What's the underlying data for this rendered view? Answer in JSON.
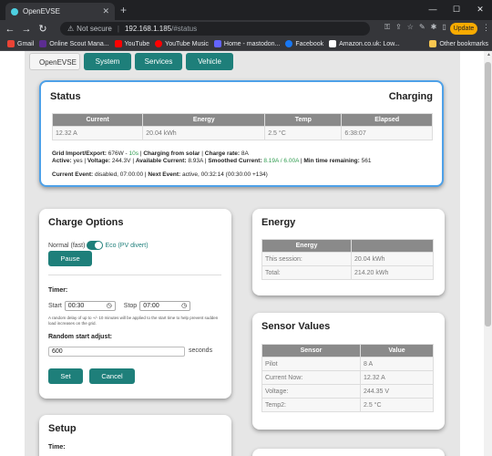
{
  "browser": {
    "tab_title": "OpenEVSE",
    "tab_close": "✕",
    "new_tab": "+",
    "window_controls": [
      "—",
      "☐",
      "✕"
    ],
    "nav": [
      "←",
      "→",
      "↻"
    ],
    "security_label": "Not secure",
    "url_host": "192.168.1.185",
    "url_path": "/#status",
    "update_label": "Update",
    "bookmarks": [
      {
        "label": "Gmail",
        "color": "#ea4335"
      },
      {
        "label": "Online Scout Mana...",
        "color": "#5c2d91"
      },
      {
        "label": "YouTube",
        "color": "#ff0000"
      },
      {
        "label": "YouTube Music",
        "color": "#ff0000"
      },
      {
        "label": "Home - mastodon...",
        "color": "#6364ff"
      },
      {
        "label": "Facebook",
        "color": "#1877f2"
      },
      {
        "label": "Amazon.co.uk: Low...",
        "color": "#ffffff"
      }
    ],
    "other_bookmarks": "Other bookmarks"
  },
  "nav_tabs": [
    "OpenEVSE",
    "System",
    "Services",
    "Vehicle"
  ],
  "status": {
    "title": "Status",
    "state": "Charging",
    "headers": [
      "Current",
      "Energy",
      "Temp",
      "Elapsed"
    ],
    "values": [
      "12.32 A",
      "20.04 kWh",
      "2.5 °C",
      "6:38:07"
    ],
    "line1_a": "Grid Import/Export:",
    "line1_b": "676W -",
    "line1_c": "10s",
    "line1_d": "|",
    "line1_e": "Charging from solar",
    "line1_f": "|",
    "line1_g": "Charge rate:",
    "line1_h": "8A",
    "line2_a": "Active:",
    "line2_b": "yes |",
    "line2_c": "Voltage:",
    "line2_d": "244.3V |",
    "line2_e": "Available Current:",
    "line2_f": "8.93A |",
    "line2_g": "Smoothed Current:",
    "line2_h": "8.19A / 6.00A",
    "line2_i": "|",
    "line2_j": "Min time remaining:",
    "line2_k": "561",
    "line3_a": "Current Event:",
    "line3_b": "disabled, 07:00:00 |",
    "line3_c": "Next Event:",
    "line3_d": "active, 00:32:14 (00:30:00 +134)"
  },
  "charge": {
    "title": "Charge Options",
    "mode_normal": "Normal (fast)",
    "mode_eco": "Eco (PV divert)",
    "pause": "Pause",
    "timer_label": "Timer:",
    "start_label": "Start",
    "start_value": "00:30",
    "stop_label": "Stop",
    "stop_value": "07:00",
    "note": "A random delay of up to +/- 10 minutes will be applied to the start time to help prevent sudden load increases on the grid.",
    "random_label": "Random start adjust:",
    "random_value": "600",
    "seconds": "seconds",
    "set": "Set",
    "cancel": "Cancel"
  },
  "energy": {
    "title": "Energy",
    "header": "Energy",
    "rows": [
      [
        "This session:",
        "20.04 kWh"
      ],
      [
        "Total:",
        "214.20 kWh"
      ]
    ]
  },
  "sensor": {
    "title": "Sensor Values",
    "headers": [
      "Sensor",
      "Value"
    ],
    "rows": [
      [
        "Pilot",
        "8 A"
      ],
      [
        "Current Now:",
        "12.32 A"
      ],
      [
        "Voltage:",
        "244.35 V"
      ],
      [
        "Temp2:",
        "2.5 °C"
      ]
    ]
  },
  "setup": {
    "title": "Setup",
    "timer_label": "Time:"
  },
  "colors": {
    "teal": "#1e7f7a",
    "accent_border": "#4ea1e8",
    "green": "#2e9b4e"
  }
}
